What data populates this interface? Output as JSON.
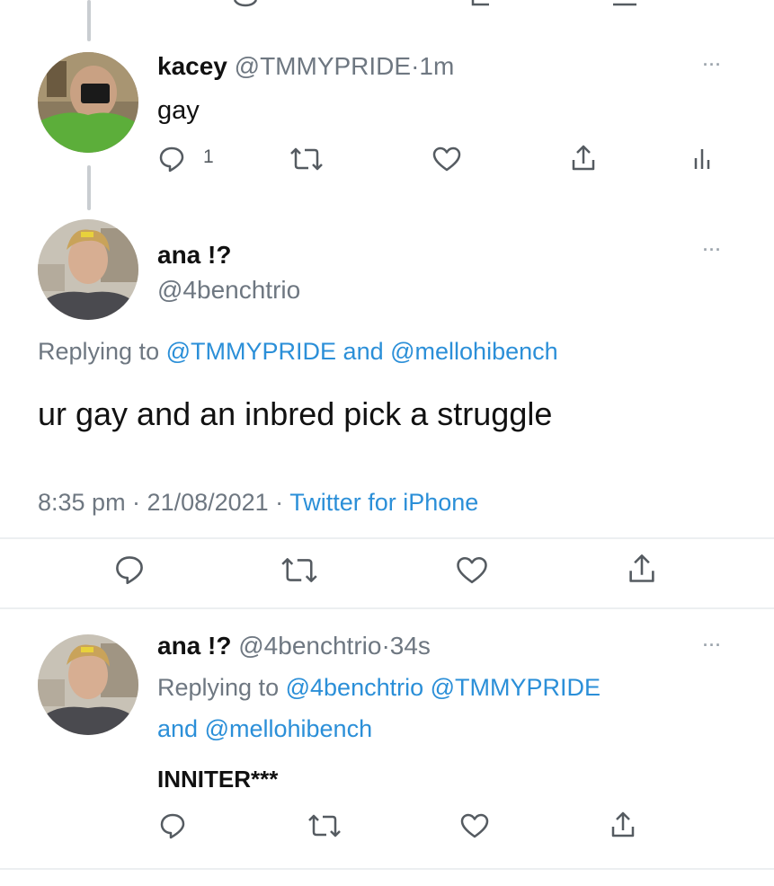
{
  "tweet1": {
    "name": "kacey",
    "handle": "@TMMYPRIDE",
    "sep": "·",
    "time": "1m",
    "text": "gay",
    "reply_count": "1",
    "more": "···"
  },
  "tweet2": {
    "name": "ana !?",
    "handle": "@4benchtrio",
    "more": "···",
    "replying_prefix": "Replying to",
    "replying_user1": "@TMMYPRIDE",
    "replying_and": "and",
    "replying_user2": "@mellohibench",
    "text": "ur gay and an inbred pick a struggle",
    "timestamp": "8:35 pm · 21/08/2021 ·",
    "source": "Twitter for iPhone"
  },
  "tweet3": {
    "name": "ana !?",
    "handle": "@4benchtrio",
    "sep": "·",
    "time": "34s",
    "more": "···",
    "replying_prefix": "Replying to",
    "replying_user1": "@4benchtrio",
    "replying_user2": "@TMMYPRIDE",
    "replying_and": "and",
    "replying_user3": "@mellohibench",
    "text": "INNITER***"
  },
  "icons": {
    "reply": "reply-icon",
    "retweet": "retweet-icon",
    "like": "heart-icon",
    "share": "share-icon",
    "analytics": "analytics-icon"
  },
  "colors": {
    "link": "#2b8fd8",
    "muted": "#6e7781",
    "icon": "#555b61"
  }
}
